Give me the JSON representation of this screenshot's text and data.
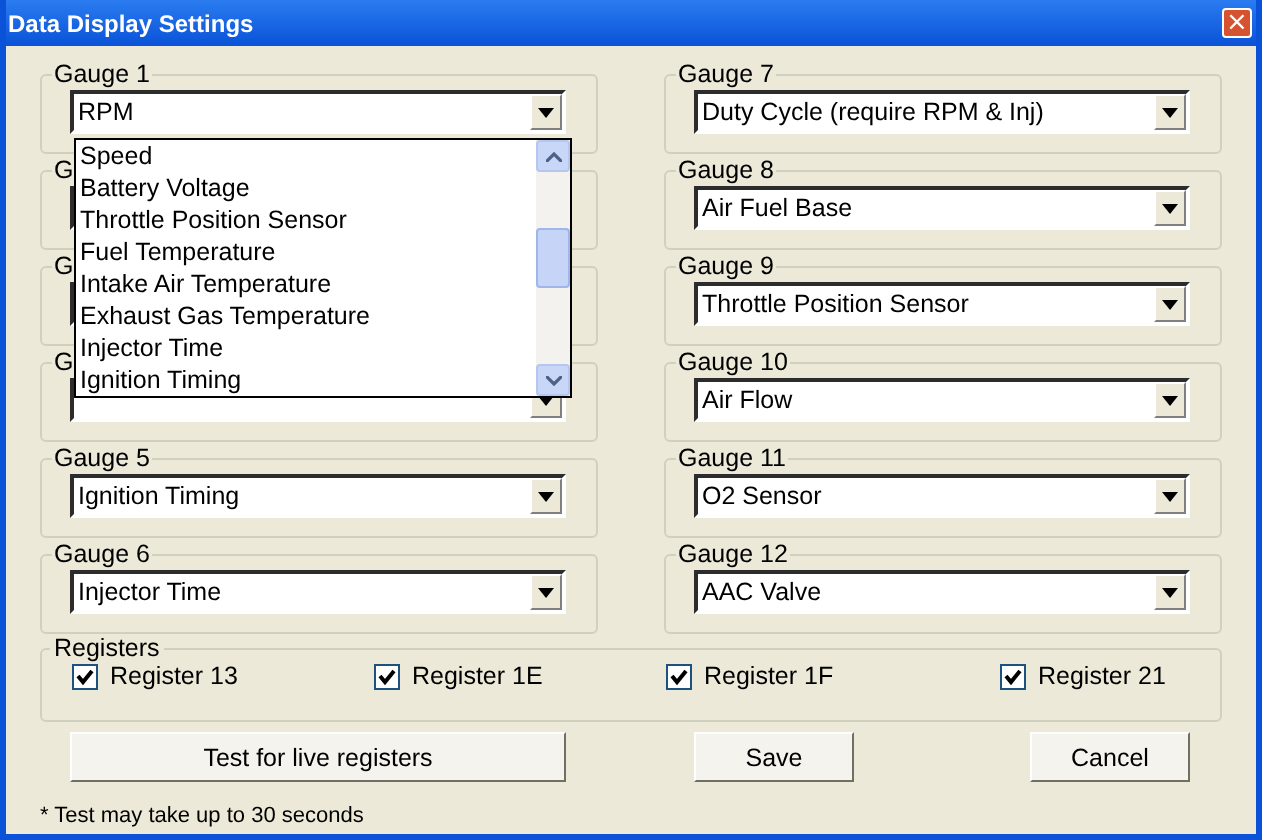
{
  "window": {
    "title": "Data Display Settings",
    "close": "×"
  },
  "left_gauges": [
    {
      "label": "Gauge 1",
      "value": "RPM"
    },
    {
      "label": "G"
    },
    {
      "label": "G"
    },
    {
      "label": "G"
    },
    {
      "label": "Gauge 5",
      "value": "Ignition Timing"
    },
    {
      "label": "Gauge 6",
      "value": "Injector Time"
    }
  ],
  "right_gauges": [
    {
      "label": "Gauge 7",
      "value": "Duty Cycle (require RPM & Inj)"
    },
    {
      "label": "Gauge 8",
      "value": "Air Fuel Base"
    },
    {
      "label": "Gauge 9",
      "value": "Throttle Position Sensor"
    },
    {
      "label": "Gauge 10",
      "value": "Air Flow"
    },
    {
      "label": "Gauge 11",
      "value": "O2 Sensor"
    },
    {
      "label": "Gauge 12",
      "value": "AAC Valve"
    }
  ],
  "dropdown_list": {
    "items": [
      "Speed",
      "Battery Voltage",
      "Throttle Position Sensor",
      "Fuel Temperature",
      "Intake Air Temperature",
      "Exhaust Gas Temperature",
      "Injector Time",
      "Ignition Timing"
    ]
  },
  "registers": {
    "title": "Registers",
    "items": [
      {
        "label": "Register 13",
        "checked": true
      },
      {
        "label": "Register 1E",
        "checked": true
      },
      {
        "label": "Register 1F",
        "checked": true
      },
      {
        "label": "Register 21",
        "checked": true
      }
    ]
  },
  "buttons": [
    "Test for live registers",
    "Save",
    "Cancel"
  ],
  "note": "* Test may take up to 30 seconds"
}
